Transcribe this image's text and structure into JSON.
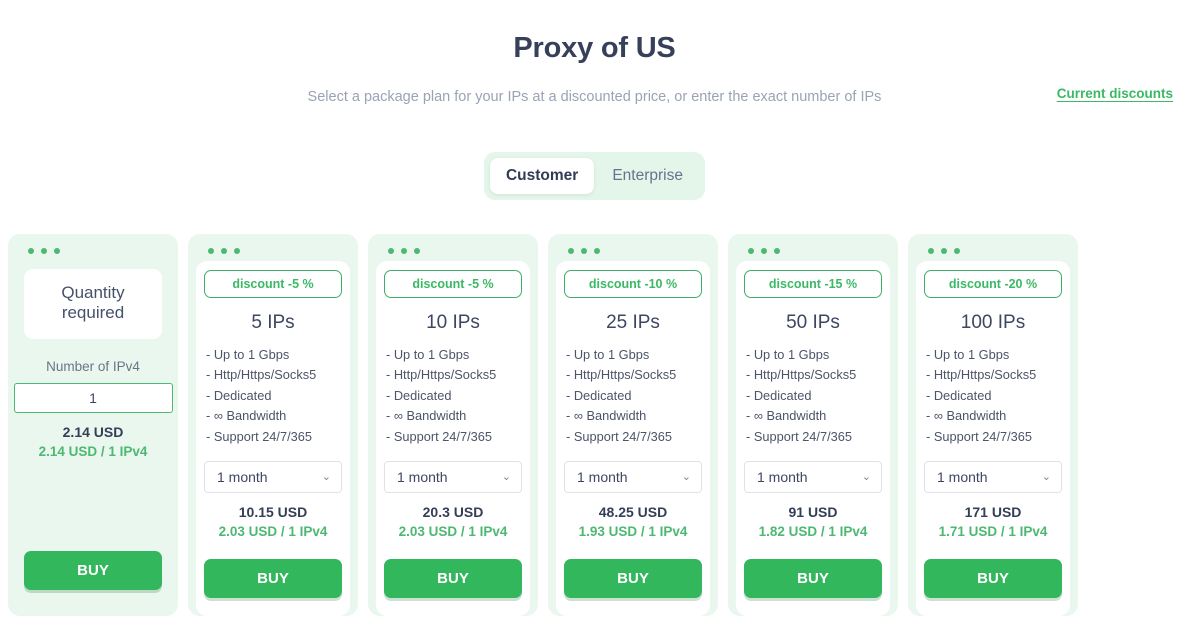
{
  "header": {
    "title": "Proxy of US",
    "subtitle": "Select a package plan for your IPs at a discounted price, or enter the exact number of IPs",
    "discount_link": "Current discounts"
  },
  "toggle": {
    "options": [
      {
        "label": "Customer",
        "active": true
      },
      {
        "label": "Enterprise",
        "active": false
      }
    ]
  },
  "colors": {
    "brand_green": "#32b75c",
    "light_green_bg": "#e9f7ee",
    "accent_text_green": "#4cb872",
    "title_navy": "#36405a",
    "muted_gray": "#9aa3b4"
  },
  "quantity_card": {
    "heading": "Quantity required",
    "field_label": "Number of IPv4",
    "input_value": "1",
    "price": "2.14 USD",
    "unit_price": "2.14 USD / 1 IPv4",
    "buy_label": "BUY"
  },
  "plans": [
    {
      "discount": "discount -5 %",
      "ips": "5 IPs",
      "features": [
        "- Up to 1 Gbps",
        "- Http/Https/Socks5",
        "- Dedicated",
        "- ∞ Bandwidth",
        "- Support 24/7/365"
      ],
      "period": "1 month",
      "price": "10.15 USD",
      "unit_price": "2.03 USD / 1 IPv4",
      "buy_label": "BUY"
    },
    {
      "discount": "discount -5 %",
      "ips": "10 IPs",
      "features": [
        "- Up to 1 Gbps",
        "- Http/Https/Socks5",
        "- Dedicated",
        "- ∞ Bandwidth",
        "- Support 24/7/365"
      ],
      "period": "1 month",
      "price": "20.3 USD",
      "unit_price": "2.03 USD / 1 IPv4",
      "buy_label": "BUY"
    },
    {
      "discount": "discount -10 %",
      "ips": "25 IPs",
      "features": [
        "- Up to 1 Gbps",
        "- Http/Https/Socks5",
        "- Dedicated",
        "- ∞ Bandwidth",
        "- Support 24/7/365"
      ],
      "period": "1 month",
      "price": "48.25 USD",
      "unit_price": "1.93 USD / 1 IPv4",
      "buy_label": "BUY"
    },
    {
      "discount": "discount -15 %",
      "ips": "50 IPs",
      "features": [
        "- Up to 1 Gbps",
        "- Http/Https/Socks5",
        "- Dedicated",
        "- ∞ Bandwidth",
        "- Support 24/7/365"
      ],
      "period": "1 month",
      "price": "91 USD",
      "unit_price": "1.82 USD / 1 IPv4",
      "buy_label": "BUY"
    },
    {
      "discount": "discount -20 %",
      "ips": "100 IPs",
      "features": [
        "- Up to 1 Gbps",
        "- Http/Https/Socks5",
        "- Dedicated",
        "- ∞ Bandwidth",
        "- Support 24/7/365"
      ],
      "period": "1 month",
      "price": "171 USD",
      "unit_price": "1.71 USD / 1 IPv4",
      "buy_label": "BUY"
    }
  ],
  "icons": {
    "chevron_down": "⌄",
    "card_dots": "three-dots"
  }
}
